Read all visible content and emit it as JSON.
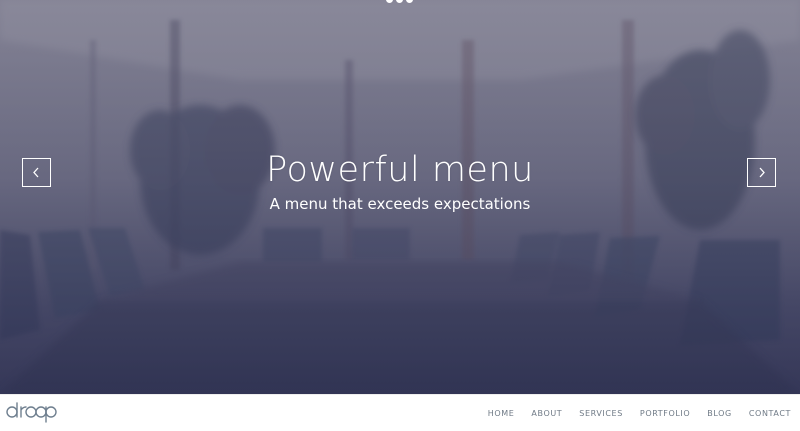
{
  "hero": {
    "title": "Powerful menu",
    "subtitle": "A menu that exceeds expectations",
    "prev_icon": "chevron-left-icon",
    "next_icon": "chevron-right-icon",
    "slide_dots": 3
  },
  "brand": {
    "logo_text": "droop",
    "logo_color": "#6f7f8f"
  },
  "nav": {
    "items": [
      {
        "label": "HOME"
      },
      {
        "label": "ABOUT"
      },
      {
        "label": "SERVICES"
      },
      {
        "label": "PORTFOLIO"
      },
      {
        "label": "BLOG"
      },
      {
        "label": "CONTACT"
      }
    ]
  },
  "colors": {
    "hero_overlay": "#4a4b6b",
    "text_light": "#ffffff",
    "nav_text": "#6f7a86"
  }
}
